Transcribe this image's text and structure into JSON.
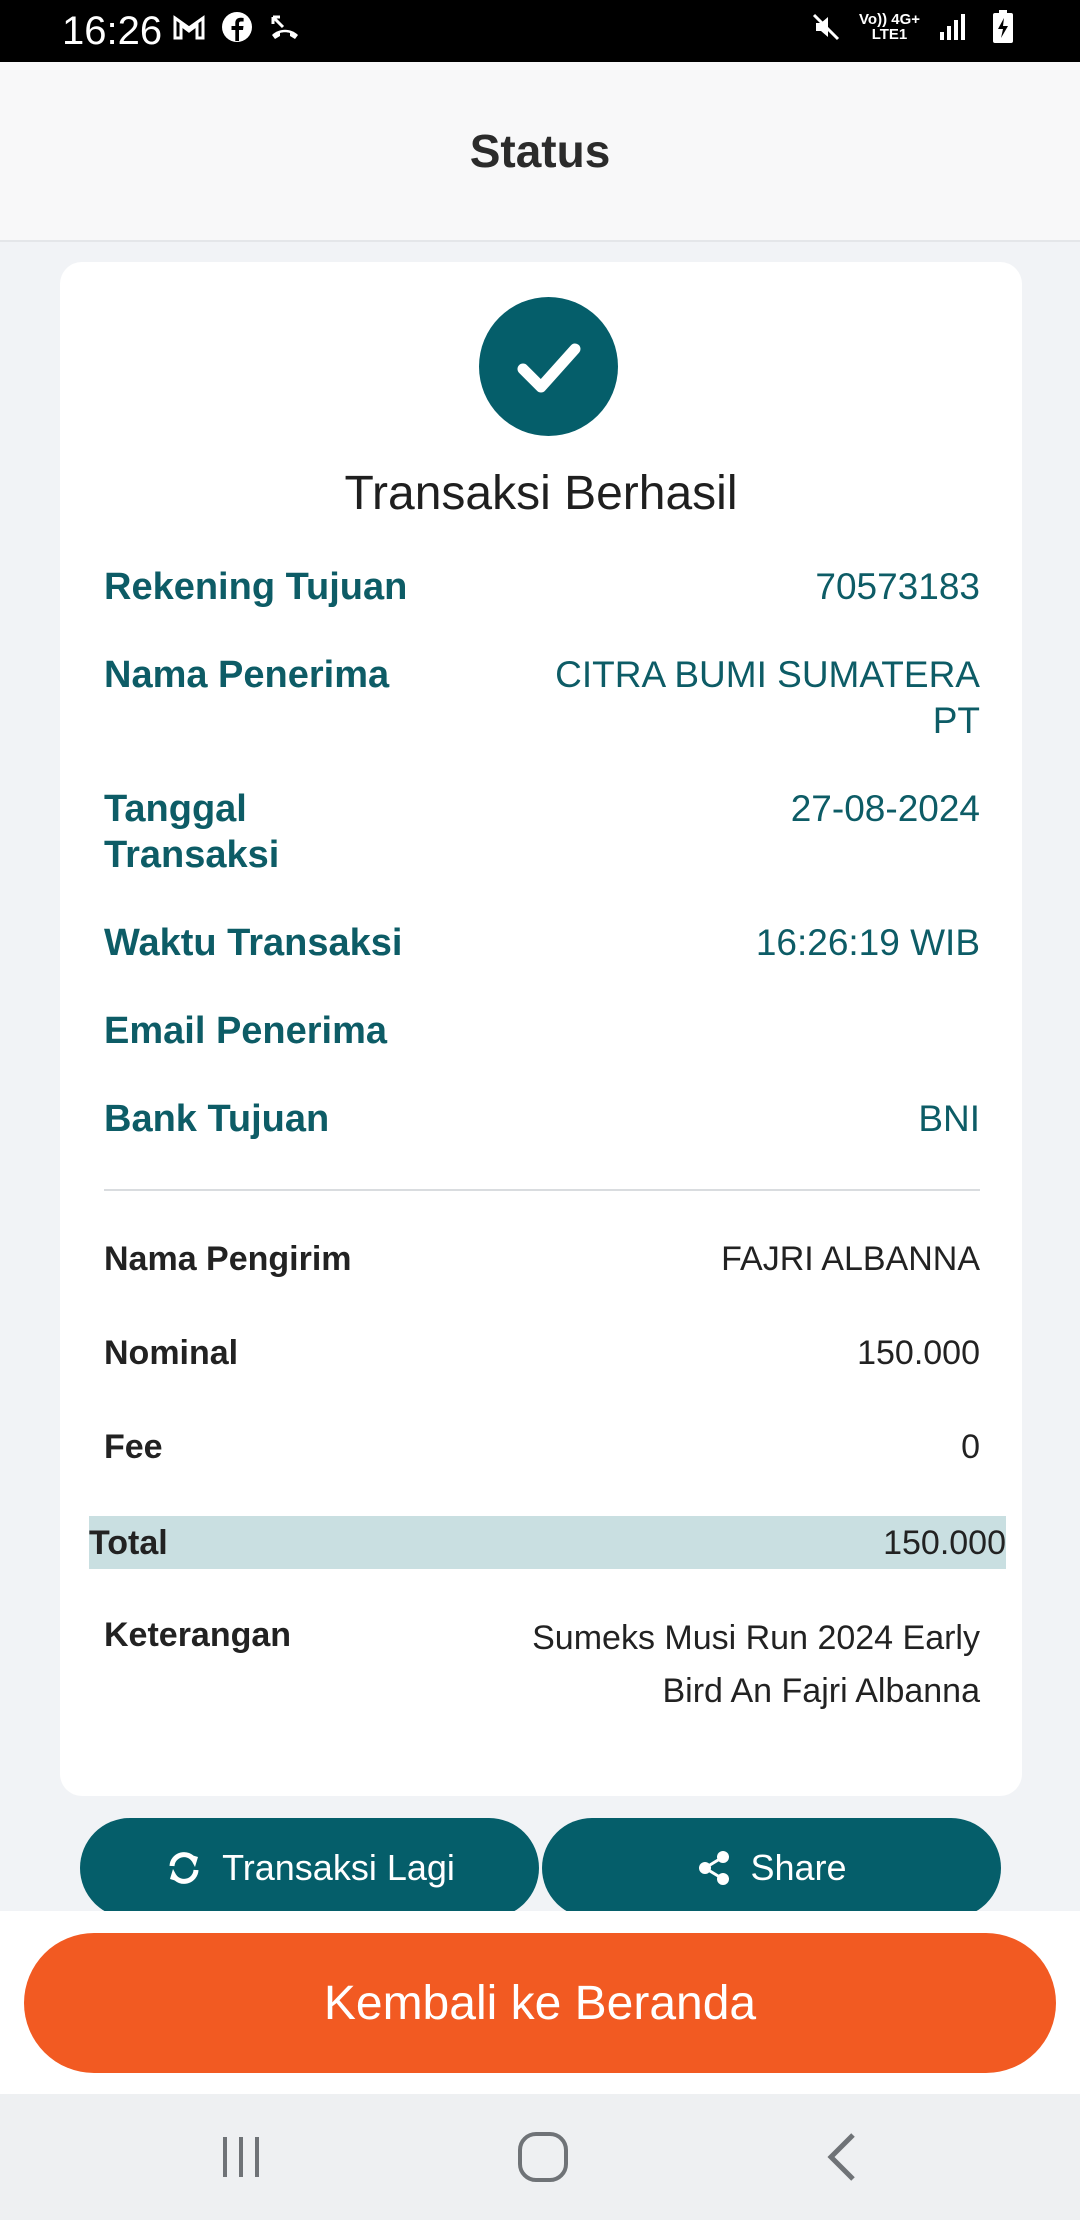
{
  "status_bar": {
    "time": "16:26",
    "left_icons": [
      "gmail-icon",
      "facebook-icon",
      "missed-call-icon"
    ],
    "right_icons": [
      "mute-icon",
      "volte-icon",
      "network-4g-icon",
      "signal-icon",
      "battery-charging-icon"
    ],
    "net_line1": "Vo)) 4G+",
    "net_line2": "LTE1"
  },
  "header": {
    "title": "Status"
  },
  "result": {
    "icon": "check-icon",
    "title": "Transaksi Berhasil",
    "details": [
      {
        "label": "Rekening Tujuan",
        "value": "70573183"
      },
      {
        "label": "Nama Penerima",
        "value": "CITRA BUMI SUMATERA PT"
      },
      {
        "label": "Tanggal Transaksi",
        "value": "27-08-2024"
      },
      {
        "label": "Waktu Transaksi",
        "value": "16:26:19 WIB"
      },
      {
        "label": "Email Penerima",
        "value": ""
      },
      {
        "label": "Bank Tujuan",
        "value": "BNI"
      }
    ],
    "summary": [
      {
        "label": "Nama Pengirim",
        "value": "FAJRI ALBANNA"
      },
      {
        "label": "Nominal",
        "value": "150.000"
      },
      {
        "label": "Fee",
        "value": "0"
      }
    ],
    "total": {
      "label": "Total",
      "value": "150.000"
    },
    "note": {
      "label": "Keterangan",
      "value": "Sumeks Musi Run 2024 Early Bird An Fajri Albanna"
    }
  },
  "actions": {
    "repeat_label": "Transaksi Lagi",
    "share_label": "Share",
    "home_label": "Kembali ke Beranda"
  },
  "colors": {
    "primary": "#055e6a",
    "accent": "#f25a22",
    "total_highlight": "#c9dfe1"
  }
}
